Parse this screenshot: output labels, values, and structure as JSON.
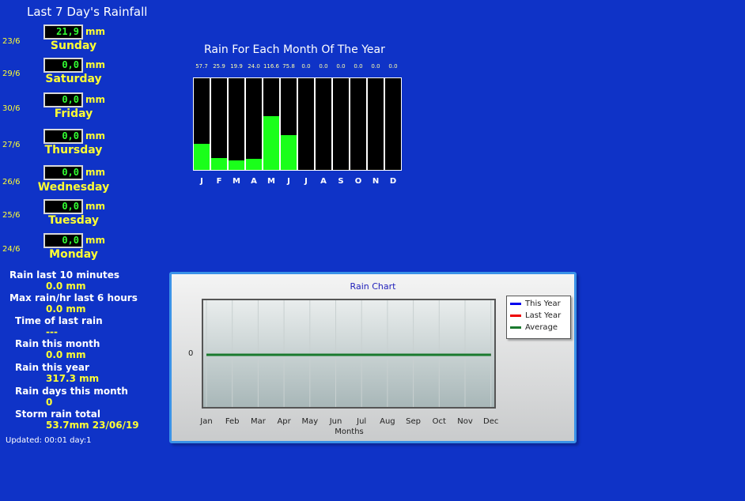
{
  "title": "Last 7 Day's Rainfall",
  "unit": "mm",
  "days": [
    {
      "date": "23/6",
      "value": "21,9",
      "name": "Sunday"
    },
    {
      "date": "29/6",
      "value": "0,0",
      "name": "Saturday"
    },
    {
      "date": "30/6",
      "value": "0,0",
      "name": "Friday"
    },
    {
      "date": "27/6",
      "value": "0,0",
      "name": "Thursday"
    },
    {
      "date": "26/6",
      "value": "0,0",
      "name": "Wednesday"
    },
    {
      "date": "25/6",
      "value": "0,0",
      "name": "Tuesday"
    },
    {
      "date": "24/6",
      "value": "0,0",
      "name": "Monday"
    }
  ],
  "stats": {
    "rain_10min_label": "Rain last 10 minutes",
    "rain_10min_value": "0.0 mm",
    "max_rain_label": "Max rain/hr last 6 hours",
    "max_rain_value": "0.0 mm",
    "last_rain_label": "Time of last rain",
    "last_rain_value": "---",
    "month_label": "Rain this month",
    "month_value": "0.0 mm",
    "year_label": "Rain this year",
    "year_value": "317.3 mm",
    "raindays_label": "Rain days this month",
    "raindays_value": "0",
    "storm_label": "Storm rain total",
    "storm_value": "53.7mm 23/06/19"
  },
  "updated": "Updated: 00:01 day:1",
  "chart_data": [
    {
      "type": "bar",
      "title": "Rain For Each Month Of The Year",
      "categories": [
        "J",
        "F",
        "M",
        "A",
        "M",
        "J",
        "J",
        "A",
        "S",
        "O",
        "N",
        "D"
      ],
      "value_labels": [
        "57.7",
        "25.9",
        "19.9",
        "24.0",
        "116.6",
        "75.8",
        "0.0",
        "0.0",
        "0.0",
        "0.0",
        "0.0",
        "0.0"
      ],
      "values": [
        57.7,
        25.9,
        19.9,
        24.0,
        116.6,
        75.8,
        0.0,
        0.0,
        0.0,
        0.0,
        0.0,
        0.0
      ],
      "ylim": [
        0,
        200
      ]
    },
    {
      "type": "line",
      "title": "Rain Chart",
      "xlabel": "Months",
      "categories": [
        "Jan",
        "Feb",
        "Mar",
        "Apr",
        "May",
        "Jun",
        "Jul",
        "Aug",
        "Sep",
        "Oct",
        "Nov",
        "Dec"
      ],
      "y_tick_labels": [
        "0"
      ],
      "series": [
        {
          "name": "This Year",
          "color": "#0000ee",
          "values": [
            0,
            0,
            0,
            0,
            0,
            0,
            0,
            0,
            0,
            0,
            0,
            0
          ]
        },
        {
          "name": "Last Year",
          "color": "#ee0000",
          "values": [
            0,
            0,
            0,
            0,
            0,
            0,
            0,
            0,
            0,
            0,
            0,
            0
          ]
        },
        {
          "name": "Average",
          "color": "#1a7a2e",
          "values": [
            0,
            0,
            0,
            0,
            0,
            0,
            0,
            0,
            0,
            0,
            0,
            0
          ]
        }
      ],
      "legend": "top-right",
      "grid": true
    }
  ]
}
